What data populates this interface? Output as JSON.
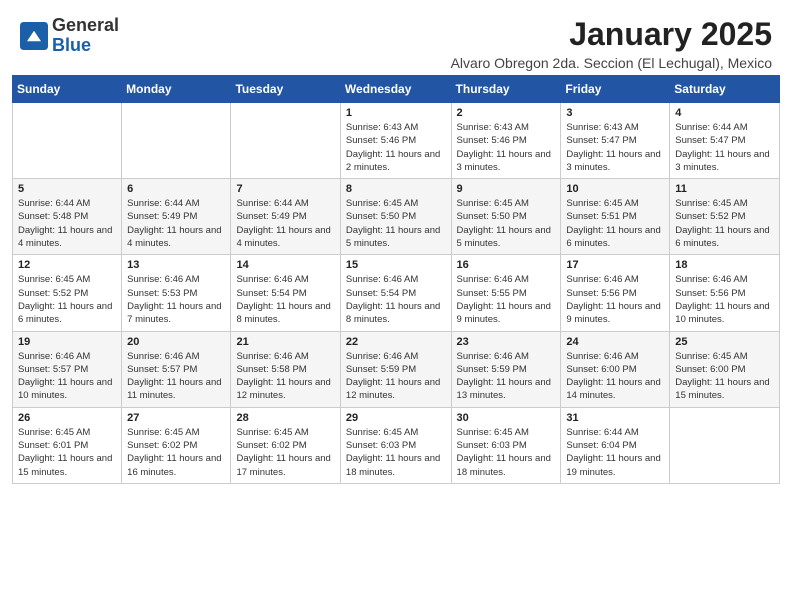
{
  "header": {
    "logo_general": "General",
    "logo_blue": "Blue",
    "title": "January 2025",
    "subtitle": "Alvaro Obregon 2da. Seccion (El Lechugal), Mexico"
  },
  "weekdays": [
    "Sunday",
    "Monday",
    "Tuesday",
    "Wednesday",
    "Thursday",
    "Friday",
    "Saturday"
  ],
  "weeks": [
    [
      {
        "day": "",
        "info": ""
      },
      {
        "day": "",
        "info": ""
      },
      {
        "day": "",
        "info": ""
      },
      {
        "day": "1",
        "info": "Sunrise: 6:43 AM\nSunset: 5:46 PM\nDaylight: 11 hours and 2 minutes."
      },
      {
        "day": "2",
        "info": "Sunrise: 6:43 AM\nSunset: 5:46 PM\nDaylight: 11 hours and 3 minutes."
      },
      {
        "day": "3",
        "info": "Sunrise: 6:43 AM\nSunset: 5:47 PM\nDaylight: 11 hours and 3 minutes."
      },
      {
        "day": "4",
        "info": "Sunrise: 6:44 AM\nSunset: 5:47 PM\nDaylight: 11 hours and 3 minutes."
      }
    ],
    [
      {
        "day": "5",
        "info": "Sunrise: 6:44 AM\nSunset: 5:48 PM\nDaylight: 11 hours and 4 minutes."
      },
      {
        "day": "6",
        "info": "Sunrise: 6:44 AM\nSunset: 5:49 PM\nDaylight: 11 hours and 4 minutes."
      },
      {
        "day": "7",
        "info": "Sunrise: 6:44 AM\nSunset: 5:49 PM\nDaylight: 11 hours and 4 minutes."
      },
      {
        "day": "8",
        "info": "Sunrise: 6:45 AM\nSunset: 5:50 PM\nDaylight: 11 hours and 5 minutes."
      },
      {
        "day": "9",
        "info": "Sunrise: 6:45 AM\nSunset: 5:50 PM\nDaylight: 11 hours and 5 minutes."
      },
      {
        "day": "10",
        "info": "Sunrise: 6:45 AM\nSunset: 5:51 PM\nDaylight: 11 hours and 6 minutes."
      },
      {
        "day": "11",
        "info": "Sunrise: 6:45 AM\nSunset: 5:52 PM\nDaylight: 11 hours and 6 minutes."
      }
    ],
    [
      {
        "day": "12",
        "info": "Sunrise: 6:45 AM\nSunset: 5:52 PM\nDaylight: 11 hours and 6 minutes."
      },
      {
        "day": "13",
        "info": "Sunrise: 6:46 AM\nSunset: 5:53 PM\nDaylight: 11 hours and 7 minutes."
      },
      {
        "day": "14",
        "info": "Sunrise: 6:46 AM\nSunset: 5:54 PM\nDaylight: 11 hours and 8 minutes."
      },
      {
        "day": "15",
        "info": "Sunrise: 6:46 AM\nSunset: 5:54 PM\nDaylight: 11 hours and 8 minutes."
      },
      {
        "day": "16",
        "info": "Sunrise: 6:46 AM\nSunset: 5:55 PM\nDaylight: 11 hours and 9 minutes."
      },
      {
        "day": "17",
        "info": "Sunrise: 6:46 AM\nSunset: 5:56 PM\nDaylight: 11 hours and 9 minutes."
      },
      {
        "day": "18",
        "info": "Sunrise: 6:46 AM\nSunset: 5:56 PM\nDaylight: 11 hours and 10 minutes."
      }
    ],
    [
      {
        "day": "19",
        "info": "Sunrise: 6:46 AM\nSunset: 5:57 PM\nDaylight: 11 hours and 10 minutes."
      },
      {
        "day": "20",
        "info": "Sunrise: 6:46 AM\nSunset: 5:57 PM\nDaylight: 11 hours and 11 minutes."
      },
      {
        "day": "21",
        "info": "Sunrise: 6:46 AM\nSunset: 5:58 PM\nDaylight: 11 hours and 12 minutes."
      },
      {
        "day": "22",
        "info": "Sunrise: 6:46 AM\nSunset: 5:59 PM\nDaylight: 11 hours and 12 minutes."
      },
      {
        "day": "23",
        "info": "Sunrise: 6:46 AM\nSunset: 5:59 PM\nDaylight: 11 hours and 13 minutes."
      },
      {
        "day": "24",
        "info": "Sunrise: 6:46 AM\nSunset: 6:00 PM\nDaylight: 11 hours and 14 minutes."
      },
      {
        "day": "25",
        "info": "Sunrise: 6:45 AM\nSunset: 6:00 PM\nDaylight: 11 hours and 15 minutes."
      }
    ],
    [
      {
        "day": "26",
        "info": "Sunrise: 6:45 AM\nSunset: 6:01 PM\nDaylight: 11 hours and 15 minutes."
      },
      {
        "day": "27",
        "info": "Sunrise: 6:45 AM\nSunset: 6:02 PM\nDaylight: 11 hours and 16 minutes."
      },
      {
        "day": "28",
        "info": "Sunrise: 6:45 AM\nSunset: 6:02 PM\nDaylight: 11 hours and 17 minutes."
      },
      {
        "day": "29",
        "info": "Sunrise: 6:45 AM\nSunset: 6:03 PM\nDaylight: 11 hours and 18 minutes."
      },
      {
        "day": "30",
        "info": "Sunrise: 6:45 AM\nSunset: 6:03 PM\nDaylight: 11 hours and 18 minutes."
      },
      {
        "day": "31",
        "info": "Sunrise: 6:44 AM\nSunset: 6:04 PM\nDaylight: 11 hours and 19 minutes."
      },
      {
        "day": "",
        "info": ""
      }
    ]
  ]
}
